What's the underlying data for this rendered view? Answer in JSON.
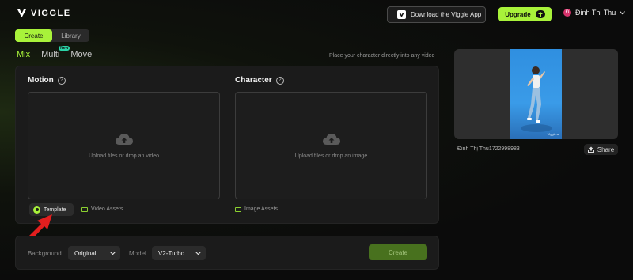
{
  "header": {
    "logo_text": "VIGGLE",
    "download_label": "Download the Viggle App",
    "upgrade_label": "Upgrade",
    "user_name": "Đinh Thị Thu",
    "user_initial": "Đ"
  },
  "top_tabs": [
    {
      "label": "Create",
      "active": true
    },
    {
      "label": "Library",
      "active": false
    }
  ],
  "mode_tabs": [
    {
      "label": "Mix",
      "active": true
    },
    {
      "label": "Multi",
      "active": false,
      "badge": "New"
    },
    {
      "label": "Move",
      "active": false
    }
  ],
  "hint": "Place your character directly into any video",
  "motion": {
    "title": "Motion",
    "drop_text": "Upload files or drop an video",
    "template_label": "Template",
    "assets_label": "Video Assets"
  },
  "character": {
    "title": "Character",
    "drop_text": "Upload files or drop an image",
    "assets_label": "Image Assets"
  },
  "bottom": {
    "background_label": "Background",
    "background_value": "Original",
    "model_label": "Model",
    "model_value": "V2-Turbo",
    "create_label": "Create"
  },
  "preview": {
    "name": "Đinh Thị Thu1722998983",
    "share_label": "Share",
    "watermark": "Viggle.ai"
  },
  "colors": {
    "accent": "#a8f23a",
    "annotation_arrow": "#e41e1e"
  }
}
